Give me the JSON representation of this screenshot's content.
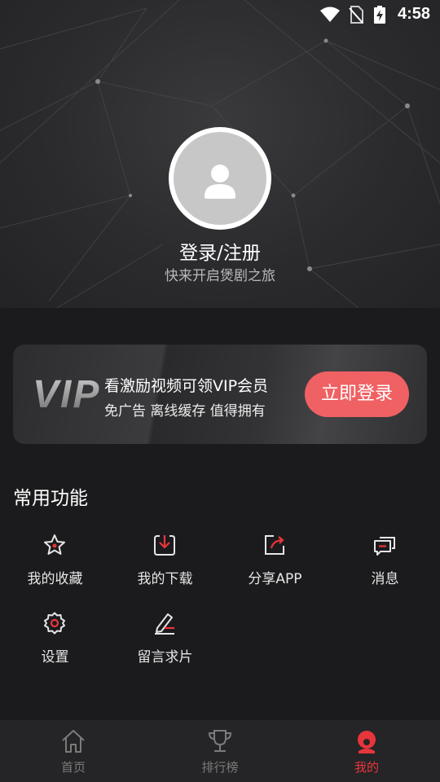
{
  "status_bar": {
    "time": "4:58",
    "icons": [
      "wifi-icon",
      "no-sim-icon",
      "battery-charging-icon"
    ]
  },
  "profile": {
    "title": "登录/注册",
    "subtitle": "快来开启煲剧之旅"
  },
  "vip_card": {
    "logo": "VIP",
    "title": "看激励视频可领VIP会员",
    "subtitle": "免广告 离线缓存 值得拥有",
    "button_label": "立即登录"
  },
  "functions": {
    "title": "常用功能",
    "items": [
      {
        "label": "我的收藏",
        "icon": "star-icon"
      },
      {
        "label": "我的下载",
        "icon": "download-icon"
      },
      {
        "label": "分享APP",
        "icon": "share-icon"
      },
      {
        "label": "消息",
        "icon": "message-icon"
      },
      {
        "label": "设置",
        "icon": "gear-icon"
      },
      {
        "label": "留言求片",
        "icon": "edit-icon"
      }
    ]
  },
  "tabbar": {
    "items": [
      {
        "label": "首页",
        "icon": "home-icon",
        "active": false
      },
      {
        "label": "排行榜",
        "icon": "trophy-icon",
        "active": false
      },
      {
        "label": "我的",
        "icon": "profile-icon",
        "active": true
      }
    ]
  },
  "colors": {
    "accent": "#f06163",
    "active_tab": "#e8353c",
    "background": "#1b1b1d"
  }
}
